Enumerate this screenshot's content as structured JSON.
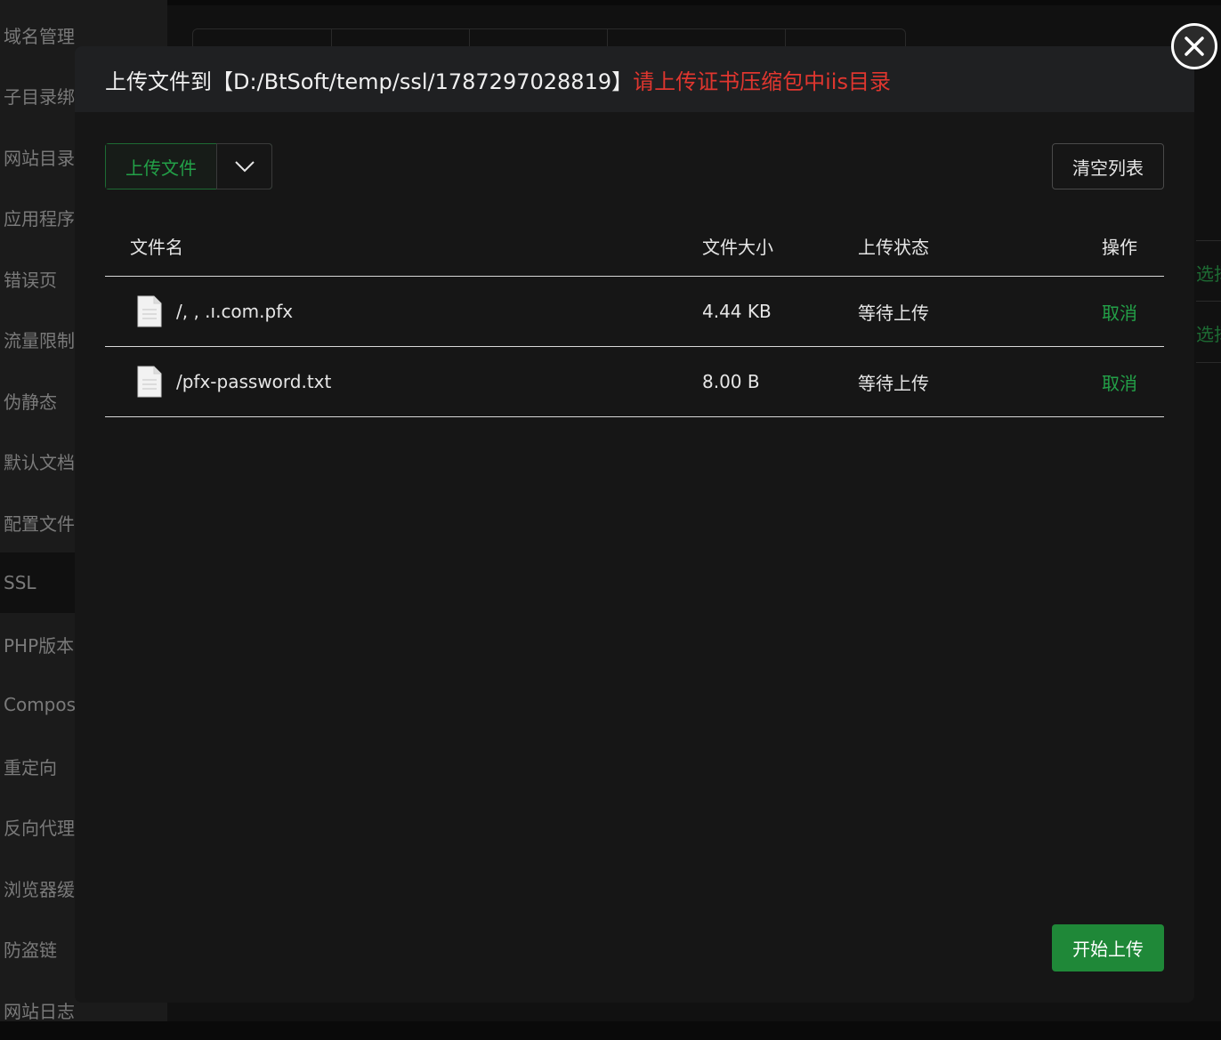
{
  "sidebar": {
    "items": [
      {
        "label": "域名管理"
      },
      {
        "label": "子目录绑"
      },
      {
        "label": "网站目录"
      },
      {
        "label": "应用程序"
      },
      {
        "label": "错误页"
      },
      {
        "label": "流量限制"
      },
      {
        "label": "伪静态"
      },
      {
        "label": "默认文档"
      },
      {
        "label": "配置文件"
      },
      {
        "label": "SSL"
      },
      {
        "label": "PHP版本"
      },
      {
        "label": "Compos"
      },
      {
        "label": "重定向"
      },
      {
        "label": "反向代理"
      },
      {
        "label": "浏览器缓"
      },
      {
        "label": "防盗链"
      },
      {
        "label": "网站日志"
      }
    ],
    "active": "SSL"
  },
  "background_right": {
    "select_1": "选择",
    "select_2": "选择"
  },
  "modal": {
    "title": "上传文件到【D:/BtSoft/temp/ssl/1787297028819】",
    "hint": "请上传证书压缩包中iis目录",
    "upload_button": "上传文件",
    "clear_button": "清空列表",
    "start_button": "开始上传",
    "columns": {
      "name": "文件名",
      "size": "文件大小",
      "status": "上传状态",
      "operation": "操作"
    },
    "files": [
      {
        "name": "/,   ,  .ı.com.pfx",
        "size": "4.44 KB",
        "status": "等待上传",
        "operation": "取消"
      },
      {
        "name": "/pfx-password.txt",
        "size": "8.00 B",
        "status": "等待上传",
        "operation": "取消"
      }
    ]
  },
  "colors": {
    "accent_green": "#23a148",
    "hint_red": "#e0362f",
    "primary_button": "#1f8838"
  }
}
